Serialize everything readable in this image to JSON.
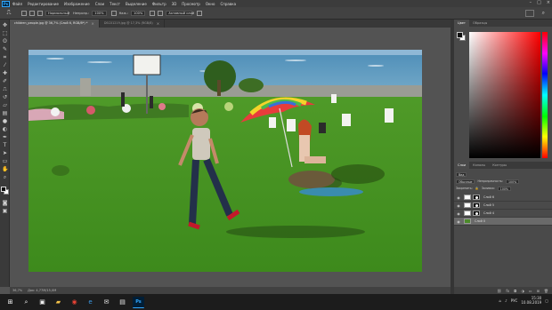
{
  "menubar": {
    "logo": "Ps",
    "items": [
      "Файл",
      "Редактирование",
      "Изображение",
      "Слои",
      "Текст",
      "Выделение",
      "Фильтр",
      "3D",
      "Просмотр",
      "Окно",
      "Справка"
    ]
  },
  "options": {
    "mode_label": "Нормальный",
    "opacity_label": "Непрозр.:",
    "opacity_value": "100%",
    "flow_label": "Наж.:",
    "flow_value": "100%",
    "active_label": "Активный слой"
  },
  "tabs": [
    {
      "label": "children_people.jpg @ 36,7% (Слой 6, RGB/8*) *",
      "active": true
    },
    {
      "label": "DSC01219.jpg @ 17,3% (RGB/8)",
      "active": false
    }
  ],
  "status": {
    "zoom": "36,7%",
    "doc": "Док: 4,77M/15,0M"
  },
  "color_panel": {
    "tabs": [
      "Цвет",
      "Образцы"
    ],
    "fg": "#111111",
    "bg": "#ffffff"
  },
  "layers_panel": {
    "tabs": [
      "Слои",
      "Каналы",
      "Контуры"
    ],
    "filter_label": "Вид",
    "blend_mode": "Обычные",
    "opacity_label": "Непрозрачность:",
    "opacity_value": "100%",
    "lock_label": "Закрепить:",
    "fill_label": "Заливка:",
    "fill_value": "100%",
    "layers": [
      {
        "name": "Слой 6",
        "thumb": "white",
        "mask": true,
        "selected": false
      },
      {
        "name": "Слой 5",
        "thumb": "white",
        "mask": true,
        "selected": false
      },
      {
        "name": "Слой 4",
        "thumb": "white",
        "mask": true,
        "selected": false
      },
      {
        "name": "Слой 0",
        "thumb": "green",
        "mask": false,
        "selected": true
      }
    ]
  },
  "taskbar": {
    "lang": "РУС",
    "time": "15:30",
    "date": "10.08.2019"
  }
}
